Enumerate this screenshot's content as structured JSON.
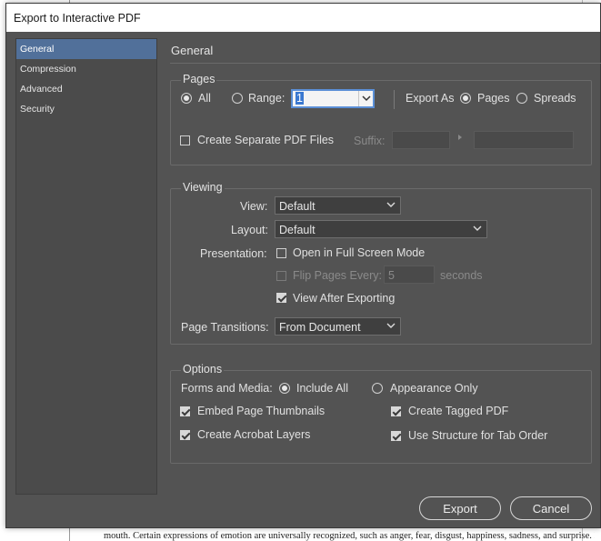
{
  "window": {
    "title": "Export to Interactive PDF"
  },
  "sidebar": {
    "items": [
      {
        "label": "General",
        "active": true
      },
      {
        "label": "Compression",
        "active": false
      },
      {
        "label": "Advanced",
        "active": false
      },
      {
        "label": "Security",
        "active": false
      }
    ]
  },
  "panel": {
    "title": "General"
  },
  "pages": {
    "title": "Pages",
    "all_label": "All",
    "range_label": "Range:",
    "range_value": "1",
    "export_as_label": "Export As",
    "pages_label": "Pages",
    "spreads_label": "Spreads",
    "create_separate_label": "Create Separate PDF Files",
    "suffix_label": "Suffix:",
    "suffix_value": ""
  },
  "viewing": {
    "title": "Viewing",
    "view_label": "View:",
    "view_value": "Default",
    "layout_label": "Layout:",
    "layout_value": "Default",
    "presentation_label": "Presentation:",
    "full_screen_label": "Open in Full Screen Mode",
    "flip_pages_label": "Flip Pages Every:",
    "flip_pages_value": "5",
    "seconds_label": "seconds",
    "view_after_label": "View After Exporting",
    "transitions_label": "Page Transitions:",
    "transitions_value": "From Document"
  },
  "options": {
    "title": "Options",
    "forms_label": "Forms and Media:",
    "include_all_label": "Include All",
    "appearance_only_label": "Appearance Only",
    "embed_thumbnails_label": "Embed Page Thumbnails",
    "create_tagged_label": "Create Tagged PDF",
    "acrobat_layers_label": "Create Acrobat Layers",
    "tab_order_label": "Use Structure for Tab Order"
  },
  "buttons": {
    "export": "Export",
    "cancel": "Cancel"
  },
  "background_doc": {
    "line1": "mouth. Certain expressions of emotion are universally recognized, such as anger, fear, disgust, happiness, sadness, and surprise. In"
  },
  "colors": {
    "dialog_bg": "#535353",
    "sidebar_active": "#51709a",
    "field_focus": "#5b8fd6"
  }
}
